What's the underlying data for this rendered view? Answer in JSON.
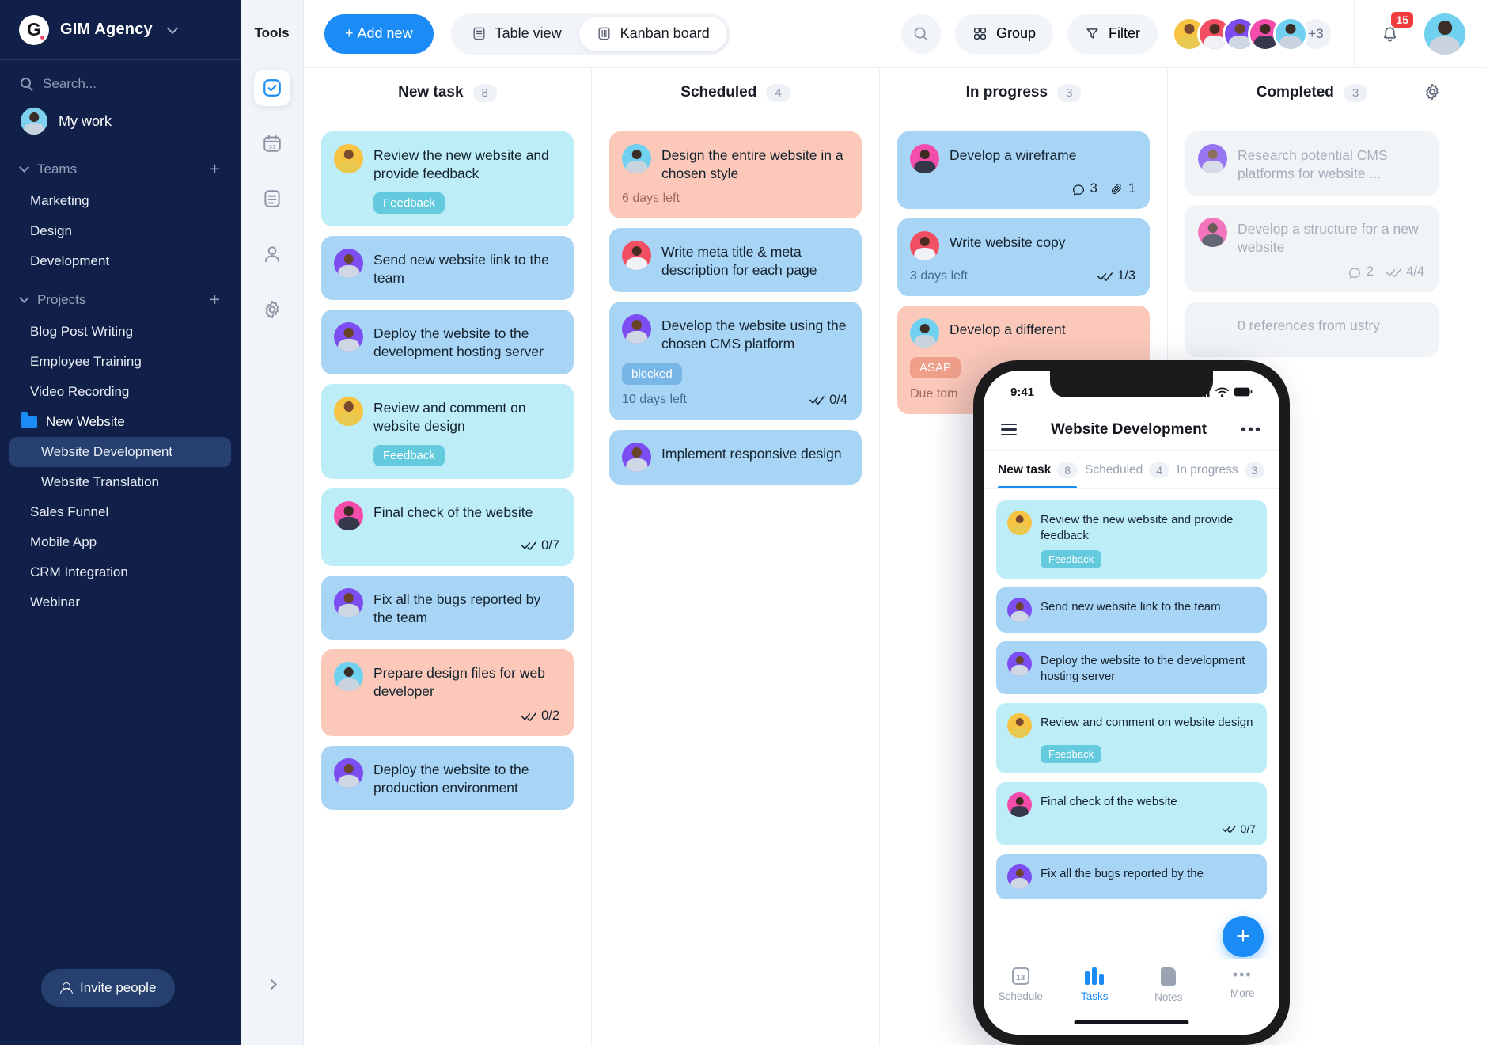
{
  "sidebar": {
    "brand": {
      "name": "GIM Agency",
      "logo_letter": "G",
      "chevron_icon": "chevron-down-icon"
    },
    "search_placeholder": "Search...",
    "my_work_label": "My work",
    "teams": {
      "title": "Teams",
      "add_label": "+",
      "items": [
        "Marketing",
        "Design",
        "Development"
      ]
    },
    "projects": {
      "title": "Projects",
      "add_label": "+",
      "items": [
        "Blog Post Writing",
        "Employee Training",
        "Video Recording"
      ],
      "folder": {
        "label": "New Website",
        "children": [
          "Website Development",
          "Website Translation"
        ],
        "active_child": "Website Development"
      },
      "items_after": [
        "Sales Funnel",
        "Mobile App",
        "CRM Integration",
        "Webinar"
      ]
    },
    "invite_label": "Invite people"
  },
  "rail": {
    "title": "Tools",
    "items": [
      {
        "name": "tasks-check-icon",
        "active": true
      },
      {
        "name": "calendar-icon",
        "active": false
      },
      {
        "name": "notes-icon",
        "active": false
      },
      {
        "name": "contacts-icon",
        "active": false
      },
      {
        "name": "settings-gear-icon",
        "active": false
      }
    ],
    "expand_label": "›"
  },
  "topbar": {
    "add_new_label": "Add new",
    "views": [
      {
        "label": "Table view",
        "icon": "table-icon",
        "active": false
      },
      {
        "label": "Kanban board",
        "icon": "kanban-icon",
        "active": true
      }
    ],
    "search_icon": "search-icon",
    "group_label": "Group",
    "filter_label": "Filter",
    "avatar_overflow": "+3",
    "notification_count": "15"
  },
  "board": {
    "settings_icon": "gear-icon",
    "columns": [
      {
        "title": "New task",
        "count": "8",
        "cards": [
          {
            "title": "Review the new website and provide feedback",
            "tag": "Feedback",
            "tone": "cyan",
            "avatar": "yellow"
          },
          {
            "title": "Send new website link to the team",
            "tone": "blue",
            "avatar": "purple"
          },
          {
            "title": "Deploy the website to the development hosting server",
            "tone": "blue",
            "avatar": "purple"
          },
          {
            "title": "Review and comment on website design",
            "tag": "Feedback",
            "tone": "cyan",
            "avatar": "yellow"
          },
          {
            "title": "Final check of the website",
            "tone": "cyan",
            "avatar": "pink",
            "checklist": "0/7"
          },
          {
            "title": "Fix all the bugs reported by the team",
            "tone": "blue",
            "avatar": "purple"
          },
          {
            "title": "Prepare design files for web developer",
            "tone": "peach",
            "avatar": "sky",
            "checklist": "0/2"
          },
          {
            "title": "Deploy the website to the production environment",
            "tone": "blue",
            "avatar": "purple"
          }
        ]
      },
      {
        "title": "Scheduled",
        "count": "4",
        "cards": [
          {
            "title": "Design the entire website in a chosen style",
            "meta": "6 days left",
            "tone": "peach",
            "avatar": "sky"
          },
          {
            "title": "Write meta title & meta description for each page",
            "tone": "blue",
            "avatar": "red"
          },
          {
            "title": "Develop the website using the chosen CMS platform",
            "tag": "blocked",
            "meta": "10 days left",
            "tone": "blue",
            "avatar": "purple",
            "checklist": "0/4"
          },
          {
            "title": "Implement responsive design",
            "tone": "blue",
            "avatar": "purple"
          }
        ]
      },
      {
        "title": "In progress",
        "count": "3",
        "cards": [
          {
            "title": "Develop a wireframe",
            "tone": "blue",
            "avatar": "pink",
            "comments": "3",
            "attachments": "1"
          },
          {
            "title": "Write website copy",
            "meta": "3 days left",
            "tone": "blue",
            "avatar": "red",
            "checklist": "1/3"
          },
          {
            "title": "Develop a different",
            "tag": "ASAP",
            "meta": "Due tom",
            "tone": "peach",
            "avatar": "sky"
          }
        ]
      },
      {
        "title": "Completed",
        "count": "3",
        "cards": [
          {
            "title": "Research potential CMS platforms for website ...",
            "tone": "done",
            "avatar": "purple"
          },
          {
            "title": "Develop a structure for a new website",
            "tone": "done",
            "avatar": "pink",
            "comments": "2",
            "checklist": "4/4"
          },
          {
            "title": "0 references from ustry",
            "tone": "done",
            "avatar": "hidden"
          }
        ]
      }
    ]
  },
  "phone": {
    "status_time": "9:41",
    "title": "Website Development",
    "menu_icon": "hamburger-icon",
    "more_icon": "more-dots-icon",
    "tabs": [
      {
        "label": "New task",
        "count": "8",
        "active": true
      },
      {
        "label": "Scheduled",
        "count": "4",
        "active": false
      },
      {
        "label": "In progress",
        "count": "3",
        "active": false
      }
    ],
    "cards": [
      {
        "title": "Review the new website and provide feedback",
        "tag": "Feedback",
        "tone": "cyan",
        "avatar": "yellow"
      },
      {
        "title": "Send new website link to the team",
        "tone": "blue",
        "avatar": "purple"
      },
      {
        "title": "Deploy the website to the development hosting server",
        "tone": "blue",
        "avatar": "purple"
      },
      {
        "title": "Review and comment on website design",
        "tag": "Feedback",
        "tone": "cyan",
        "avatar": "yellow"
      },
      {
        "title": "Final check of the website",
        "tone": "cyan",
        "avatar": "pink",
        "checklist": "0/7"
      },
      {
        "title": "Fix all the bugs reported by the",
        "tone": "blue",
        "avatar": "purple"
      }
    ],
    "fab_label": "+",
    "nav": [
      {
        "label": "Schedule",
        "icon": "calendar-icon",
        "active": false
      },
      {
        "label": "Tasks",
        "icon": "tasks-bars-icon",
        "active": true
      },
      {
        "label": "Notes",
        "icon": "notes-icon",
        "active": false
      },
      {
        "label": "More",
        "icon": "more-dots-icon",
        "active": false
      }
    ],
    "calendar_day": "13"
  },
  "colors": {
    "accent": "#1b8cf6",
    "sidebar_bg": "#102048",
    "card_cyan": "#bdeef7",
    "card_blue": "#a8d4f5",
    "card_peach": "#fbc8b9",
    "card_done": "#f1f4f7",
    "tag_cyan": "#63cbdd",
    "tag_blue": "#79b6e8",
    "tag_peach": "#ef9f8a",
    "badge_red": "#ef3b3b"
  }
}
